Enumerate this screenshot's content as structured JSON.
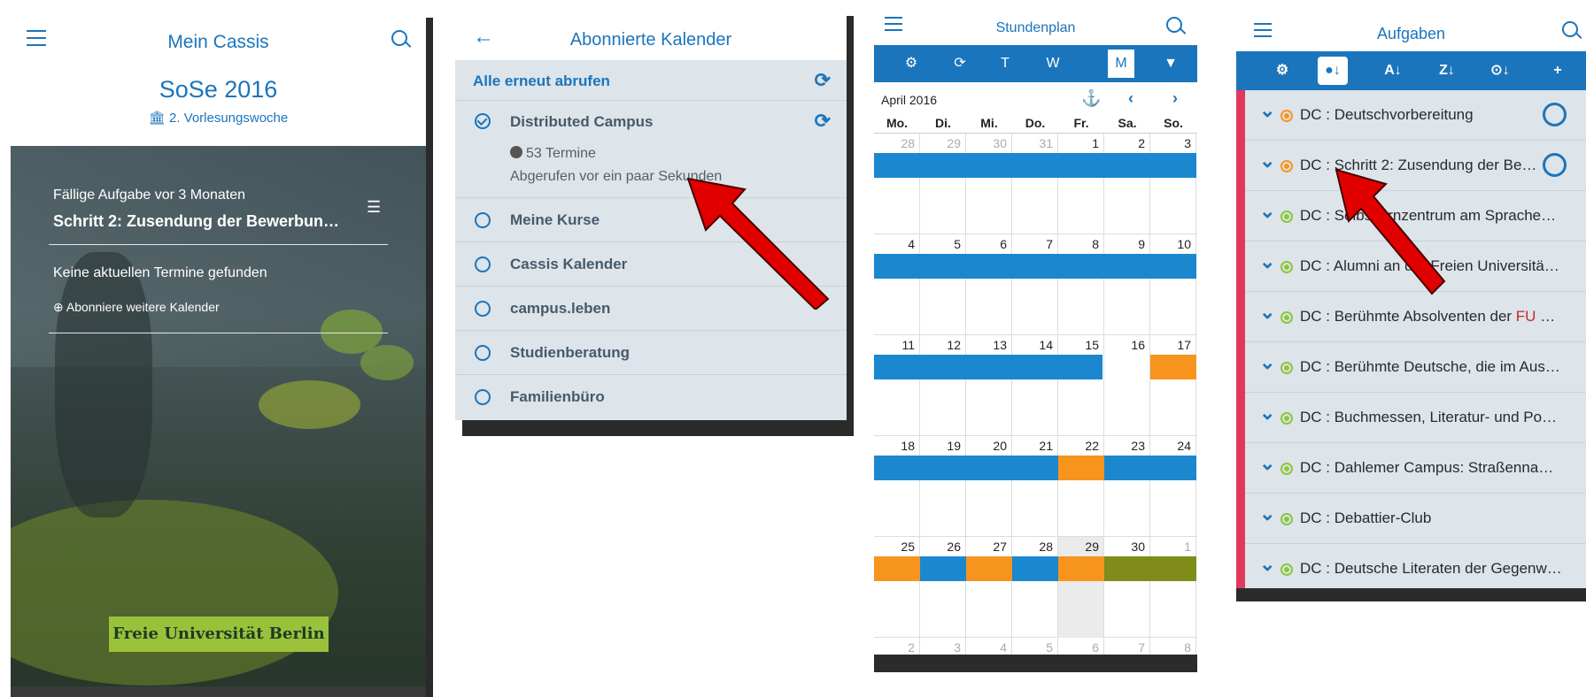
{
  "panel1": {
    "title": "Mein Cassis",
    "semester": "SoSe 2016",
    "week": "🏛 2. Vorlesungswoche",
    "due_label": "Fällige Aufgabe vor 3 Monaten",
    "due_task": "Schritt 2: Zusendung der Bewerbun…",
    "no_events": "Keine aktuellen Termine gefunden",
    "subscribe": "Abonniere weitere Kalender",
    "logo": "Freie Universität Berlin"
  },
  "panel2": {
    "title": "Abonnierte Kalender",
    "refresh_all": "Alle erneut abrufen",
    "calendars": [
      {
        "name": "Distributed Campus",
        "subscribed": true,
        "events": "53 Termine",
        "fetched": "Abgerufen vor ein paar Sekunden"
      },
      {
        "name": "Meine Kurse",
        "subscribed": false
      },
      {
        "name": "Cassis Kalender",
        "subscribed": false
      },
      {
        "name": "campus.leben",
        "subscribed": false
      },
      {
        "name": "Studienberatung",
        "subscribed": false
      },
      {
        "name": "Familienbüro",
        "subscribed": false
      }
    ]
  },
  "panel3": {
    "title": "Stundenplan",
    "toolbar": [
      "⚙",
      "⟳",
      "T",
      "W",
      "M",
      "▼"
    ],
    "selected_view": "M",
    "month": "April 2016",
    "days": [
      "Mo.",
      "Di.",
      "Mi.",
      "Do.",
      "Fr.",
      "Sa.",
      "So."
    ],
    "weeks": [
      [
        "28",
        "29",
        "30",
        "31",
        "1",
        "2",
        "3"
      ],
      [
        "4",
        "5",
        "6",
        "7",
        "8",
        "9",
        "10"
      ],
      [
        "11",
        "12",
        "13",
        "14",
        "15",
        "16",
        "17"
      ],
      [
        "18",
        "19",
        "20",
        "21",
        "22",
        "23",
        "24"
      ],
      [
        "25",
        "26",
        "27",
        "28",
        "29",
        "30",
        "1"
      ],
      [
        "2",
        "3",
        "4",
        "5",
        "6",
        "7",
        "8"
      ]
    ]
  },
  "panel4": {
    "title": "Aufgaben",
    "toolbar": [
      "⚙",
      "●↓",
      "A↓",
      "Z↓",
      "⊙↓",
      "+"
    ],
    "tasks": [
      {
        "text": "DC : Deutschvorbereitung",
        "status": "orange",
        "circle": true
      },
      {
        "text": "DC : Schritt 2: Zusendung der Be…",
        "status": "orange",
        "circle": true
      },
      {
        "text": "DC : Selbstlernzentrum am Sprache…",
        "status": "green",
        "circle": false
      },
      {
        "text": "DC : Alumni an der Freien Universitä…",
        "status": "green",
        "circle": false
      },
      {
        "text": "DC : Berühmte Absolventen der ",
        "highlight": "FU",
        "suffix": " …",
        "status": "green",
        "circle": false
      },
      {
        "text": "DC : Berühmte Deutsche, die im Aus…",
        "status": "green",
        "circle": false
      },
      {
        "text": "DC : Buchmessen, Literatur- und Po…",
        "status": "green",
        "circle": false
      },
      {
        "text": "DC : Dahlemer Campus: Straßenna…",
        "status": "green",
        "circle": false
      },
      {
        "text": "DC : Debattier-Club",
        "status": "green",
        "circle": false
      },
      {
        "text": "DC : Deutsche Literaten der Gegenw…",
        "status": "green",
        "circle": false
      }
    ]
  },
  "colors": {
    "accent": "#1b75bc",
    "event_blue": "#1b87cf",
    "event_orange": "#f7941d",
    "event_olive": "#7f8c1a",
    "task_accent": "#e0395d",
    "status_orange": "#f7941d",
    "status_green": "#8cc63f",
    "arrow": "#e00000"
  }
}
